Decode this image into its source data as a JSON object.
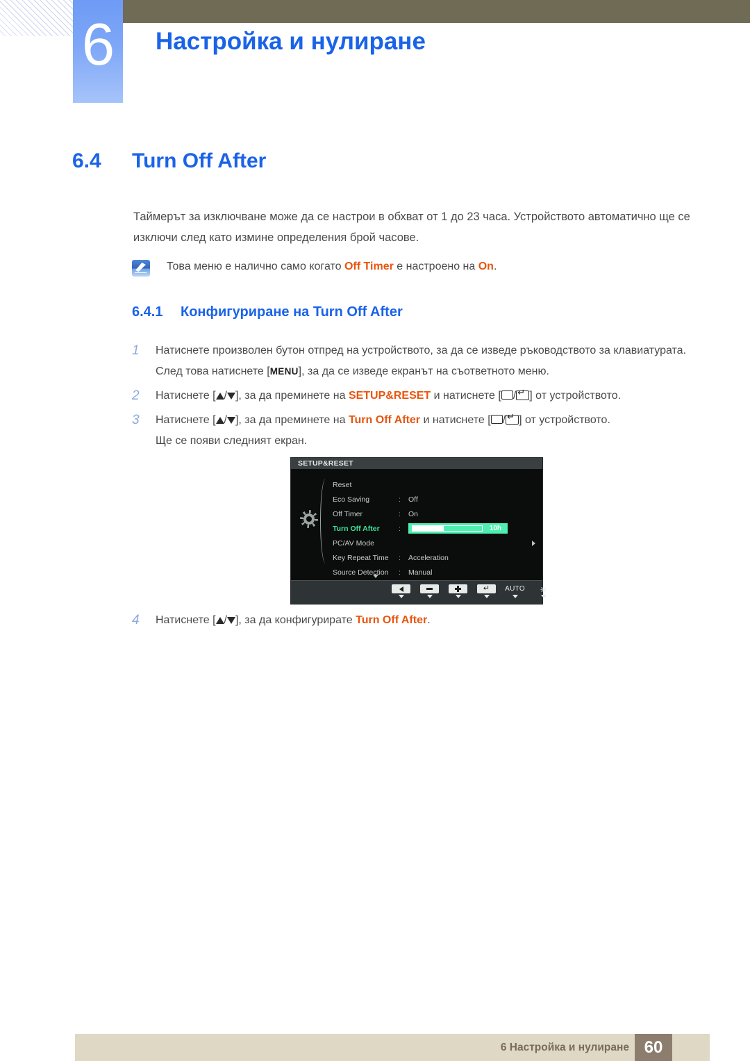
{
  "chapter": {
    "number": "6",
    "title": "Настройка и нулиране"
  },
  "section": {
    "number": "6.4",
    "title": "Turn Off After"
  },
  "body": {
    "paragraph": "Таймерът за изключване може да се настрои в обхват от 1 до 23 часа. Устройството автоматично ще се изключи след като измине определения брой часове."
  },
  "note": {
    "icon": "note-quill-icon",
    "text_before": "Това меню е налично само когато ",
    "highlight_1": "Off Timer",
    "text_middle": " е настроено на ",
    "highlight_2": "On",
    "text_after": "."
  },
  "subsection": {
    "number": "6.4.1",
    "title": "Конфигуриране на Turn Off After"
  },
  "steps": [
    {
      "num": "1",
      "part_1": "Натиснете произволен бутон отпред на устройството, за да се изведе ръководството за клавиатурата. След това натиснете [",
      "kbd": "MENU",
      "part_2": "], за да се изведе екранът на съответното меню."
    },
    {
      "num": "2",
      "part_1": "Натиснете [",
      "keys": "▲/▼",
      "part_2": "], за да преминете на ",
      "accent": "SETUP&RESET",
      "part_3": " и натиснете [",
      "part_4": "] от устройството."
    },
    {
      "num": "3",
      "part_1": "Натиснете [",
      "keys": "▲/▼",
      "part_2": "], за да преминете на ",
      "accent": "Turn Off After",
      "part_3": " и натиснете [",
      "part_4": "] от устройството.",
      "part_5": "Ще се появи следният екран."
    },
    {
      "num": "4",
      "part_1": "Натиснете [",
      "keys": "▲/▼",
      "part_2": "], за да конфигурирате ",
      "accent": "Turn Off After",
      "part_3": "."
    }
  ],
  "osd": {
    "title": "SETUP&RESET",
    "menu_icon": "gear-icon",
    "rows": [
      {
        "label": "Reset",
        "colon": "",
        "value": ""
      },
      {
        "label": "Eco Saving",
        "colon": ":",
        "value": "Off"
      },
      {
        "label": "Off Timer",
        "colon": ":",
        "value": "On"
      },
      {
        "label": "Turn Off After",
        "colon": ":",
        "value": "10h",
        "type": "slider",
        "slider_percent": 45,
        "active": true
      },
      {
        "label": "PC/AV Mode",
        "colon": "",
        "value": "",
        "type": "submenu"
      },
      {
        "label": "Key Repeat Time",
        "colon": ":",
        "value": "Acceleration"
      },
      {
        "label": "Source Detection",
        "colon": ":",
        "value": "Manual"
      }
    ],
    "scroll_down_icon": "chevron-down-icon",
    "buttons": [
      {
        "name": "back-button",
        "glyph": "left-triangle-icon",
        "label": ""
      },
      {
        "name": "minus-button",
        "glyph": "minus-icon",
        "label": ""
      },
      {
        "name": "plus-button",
        "glyph": "plus-icon",
        "label": ""
      },
      {
        "name": "enter-button",
        "glyph": "enter-icon",
        "label": ""
      },
      {
        "name": "auto-button",
        "glyph": "",
        "label": "AUTO"
      },
      {
        "name": "power-button",
        "glyph": "power-icon",
        "label": ""
      }
    ],
    "accent_color": "#4ef0b2",
    "active_label_color": "#3ce39b"
  },
  "footer": {
    "text": "6 Настройка и нулиране",
    "page_number": "60"
  },
  "colors": {
    "heading_blue": "#1a63e8",
    "header_bar": "#706b55",
    "accent_orange": "#e8540d",
    "footer_bar": "#ded8c4",
    "page_box": "#8d7d6f"
  }
}
